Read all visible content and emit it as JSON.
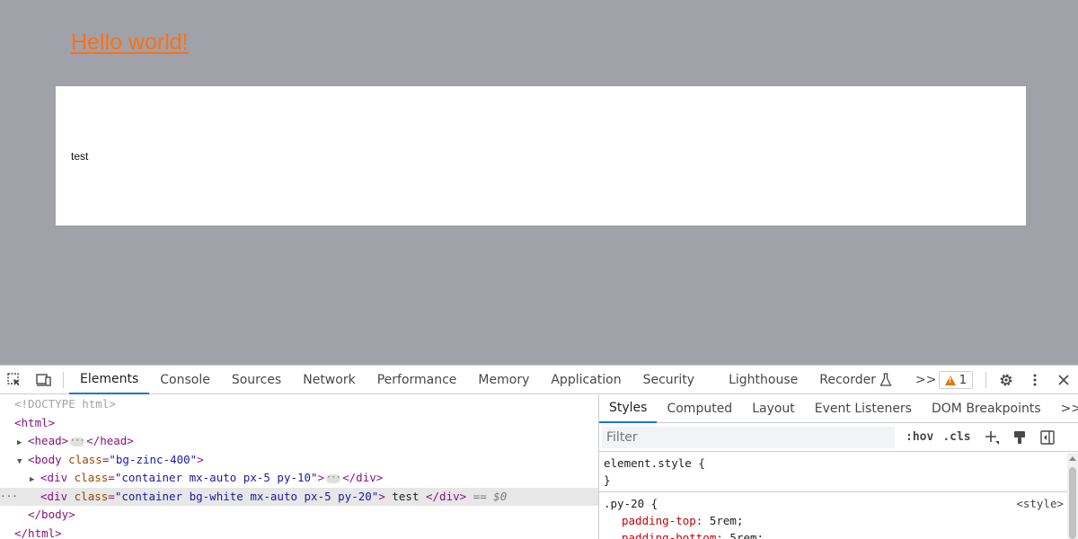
{
  "page": {
    "heading": "Hello world!",
    "box_text": "test"
  },
  "devtools": {
    "tabs": [
      "Elements",
      "Console",
      "Sources",
      "Network",
      "Performance",
      "Memory",
      "Application",
      "Security",
      "Lighthouse",
      "Recorder"
    ],
    "more_tabs": ">>",
    "warning_count": "1",
    "dom": {
      "doctype": "<!DOCTYPE html>",
      "html_open": "<html>",
      "head_open": "<head>",
      "head_close": "</head>",
      "body_open_tag": "<body",
      "body_attr": "class",
      "body_val": "\"bg-zinc-400\"",
      "body_open_end": ">",
      "div1_tag": "<div",
      "div1_attr": "class",
      "div1_val": "\"container mx-auto px-5 py-10\"",
      "div1_end": ">",
      "div1_close": "</div>",
      "div2_tag": "<div",
      "div2_attr": "class",
      "div2_val": "\"container bg-white mx-auto px-5 py-20\"",
      "div2_end": ">",
      "div2_text": " test ",
      "div2_close": "</div>",
      "div2_ref": " == $0",
      "body_close": "</body>",
      "html_close": "</html>",
      "gutter": "···",
      "eq": "="
    },
    "styles": {
      "sub_tabs": [
        "Styles",
        "Computed",
        "Layout",
        "Event Listeners",
        "DOM Breakpoints"
      ],
      "more": ">>",
      "filter_placeholder": "Filter",
      "hov": ":hov",
      "cls": ".cls",
      "element_style_selector": "element.style {",
      "close_brace": "}",
      "py20_selector": ".py-20 {",
      "py20_source": "<style>",
      "prop1_name": "padding-top",
      "prop1_val": "5rem;",
      "prop2_name": "padding-bottom",
      "prop2_val": "5rem;",
      "colon": ": "
    },
    "colors": {
      "accent": "#1a73e8",
      "warning": "#e37400"
    }
  }
}
